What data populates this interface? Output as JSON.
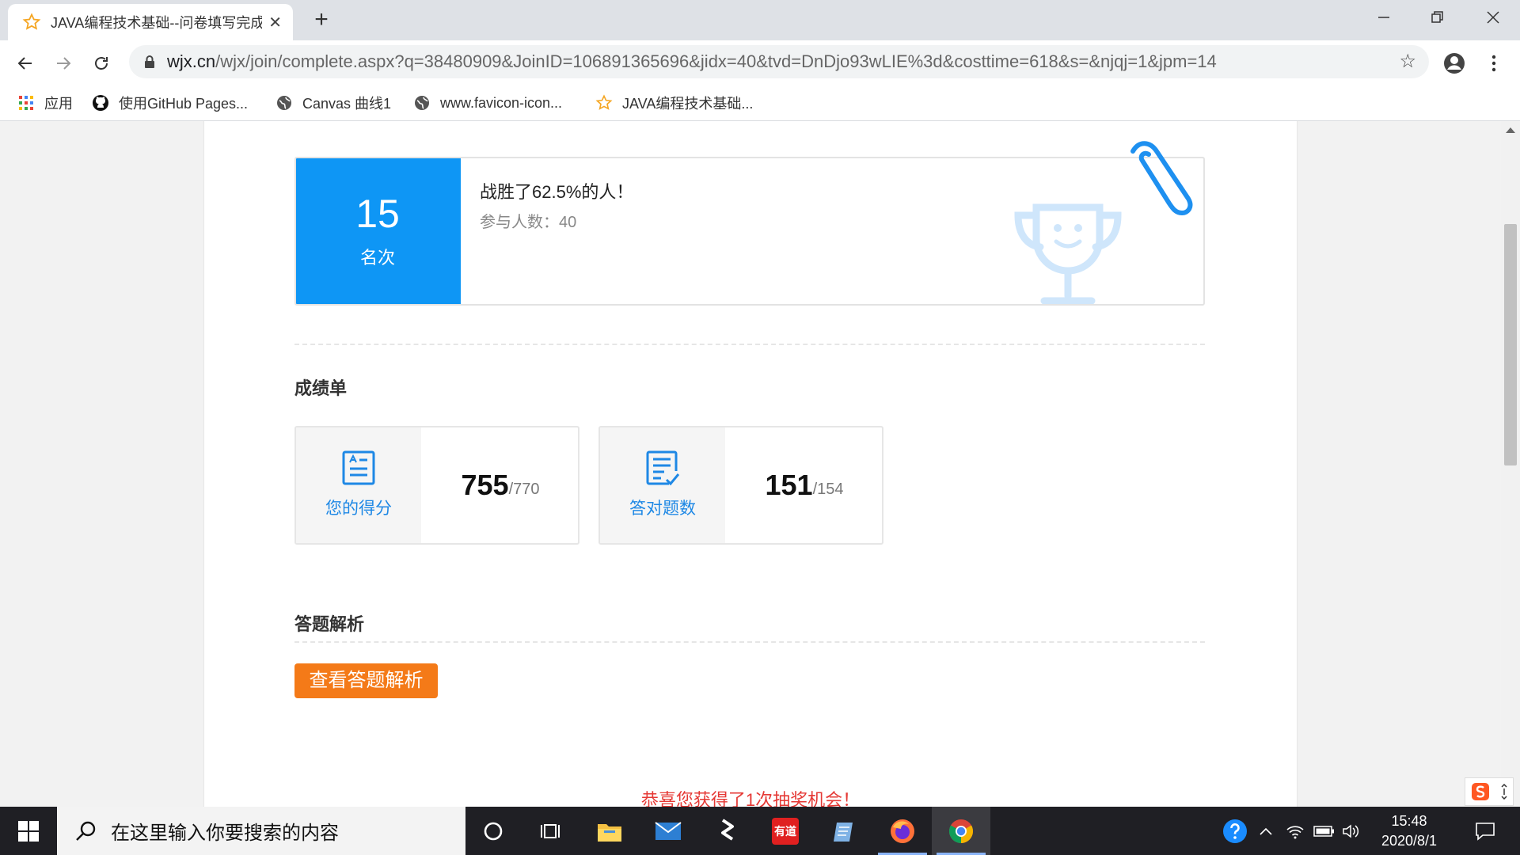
{
  "browser": {
    "tab_title": "JAVA编程技术基础--问卷填写完成",
    "url_host": "wjx.cn",
    "url_rest": "/wjx/join/complete.aspx?q=38480909&JoinID=106891365696&jidx=40&tvd=DnDjo93wLIE%3d&costtime=618&s=&njqj=1&jpm=14",
    "bookmarks": [
      {
        "label": "应用",
        "icon": "apps-grid-icon"
      },
      {
        "label": "使用GitHub Pages...",
        "icon": "github-icon"
      },
      {
        "label": "Canvas 曲线1",
        "icon": "globe-icon"
      },
      {
        "label": "www.favicon-icon...",
        "icon": "globe-icon"
      },
      {
        "label": "JAVA编程技术基础...",
        "icon": "star-icon"
      }
    ]
  },
  "rank": {
    "number": "15",
    "unit": "名次",
    "title": "战胜了62.5%的人！",
    "participants_label": "参与人数：40"
  },
  "report": {
    "title": "成绩单",
    "score": {
      "label": "您的得分",
      "value": "755",
      "total": "/770"
    },
    "correct": {
      "label": "答对题数",
      "value": "151",
      "total": "/154"
    }
  },
  "analysis": {
    "title": "答题解析",
    "button_label": "查看答题解析"
  },
  "lottery_text": "恭喜您获得了1次抽奖机会！",
  "taskbar": {
    "search_placeholder": "在这里输入你要搜索的内容",
    "time": "15:48",
    "date": "2020/8/1",
    "youdao_label": "有道"
  },
  "colors": {
    "rank_blue": "#0e96f5",
    "accent_orange": "#f47a18",
    "lottery_red": "#e53935",
    "icon_blue": "#1e88e5"
  }
}
